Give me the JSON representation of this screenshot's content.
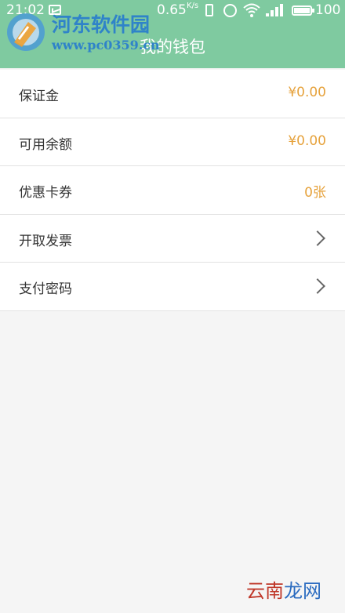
{
  "status_bar": {
    "time": "21:02",
    "network_speed": "0.65",
    "network_speed_unit": "K/s",
    "battery_level": "100",
    "icons": [
      "message-icon",
      "vibrate-icon",
      "alarm-icon",
      "wifi-icon",
      "signal-icon",
      "battery-icon"
    ]
  },
  "header": {
    "title": "我的钱包",
    "background_color": "#7fcaa0"
  },
  "watermark": {
    "name": "河东软件园",
    "url": "www.pc0359.cn",
    "footer_text_1": "云南",
    "footer_text_2": "龙网"
  },
  "wallet": {
    "items": [
      {
        "label": "保证金",
        "value": "¥0.00"
      },
      {
        "label": "可用余额",
        "value": "¥0.00"
      },
      {
        "label": "优惠卡券",
        "value": "0张"
      },
      {
        "label": "开取发票",
        "value": ""
      },
      {
        "label": "支付密码",
        "value": ""
      }
    ],
    "value_color": "#e6a23c"
  }
}
